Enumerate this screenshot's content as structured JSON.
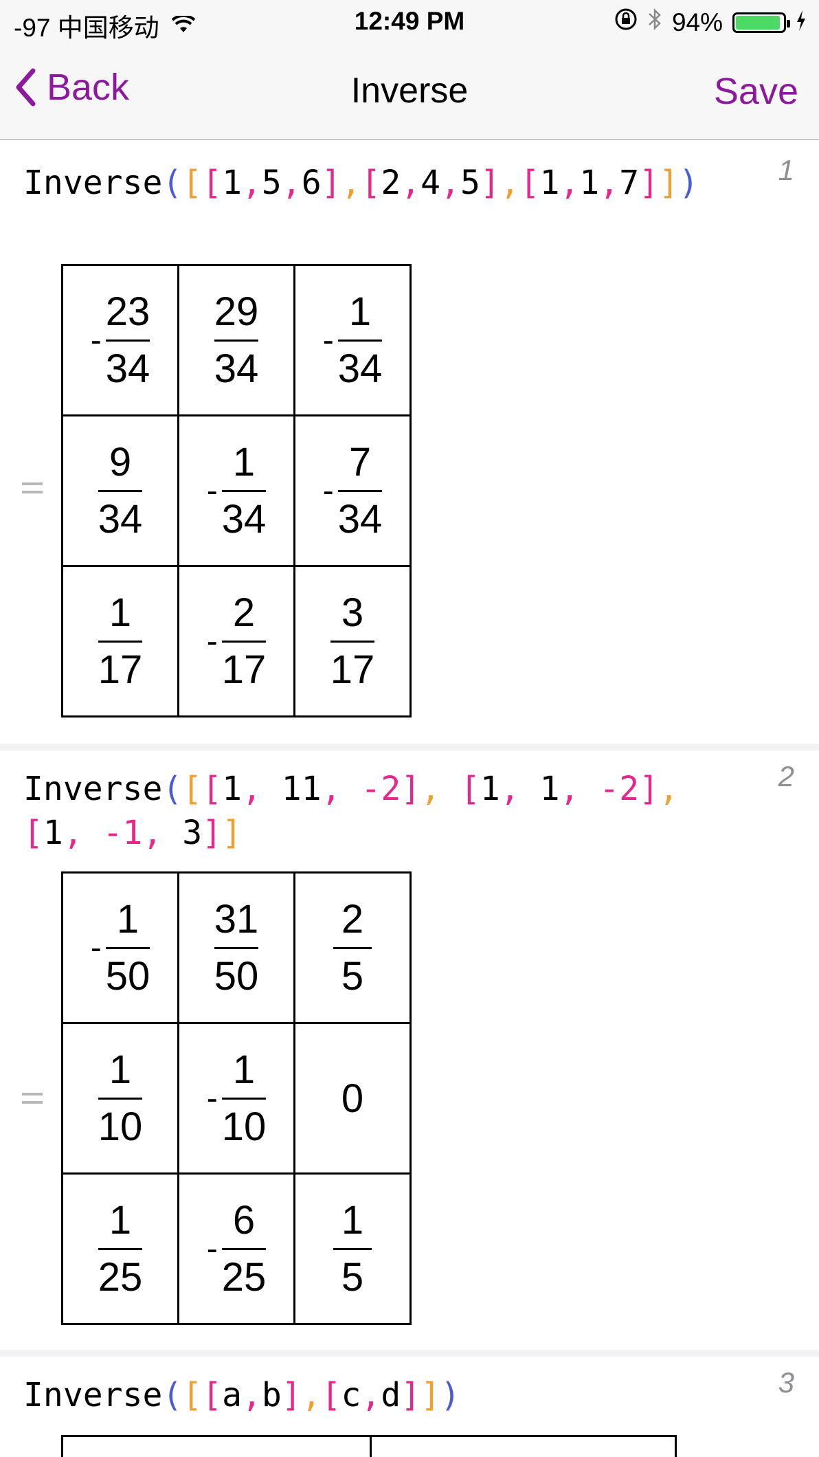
{
  "status_bar": {
    "signal": "-97 中国移动",
    "time": "12:49 PM",
    "battery": "94%",
    "battery_level": 0.94
  },
  "nav": {
    "back_label": "Back",
    "title": "Inverse",
    "save_label": "Save"
  },
  "colors": {
    "accent": "#8b1a9c",
    "paren": "#4a5bd6",
    "bracket_outer": "#f0a030",
    "bracket_inner": "#e6288c"
  },
  "entries": [
    {
      "number": "1",
      "expression": "Inverse([[1,5,6],[2,4,5],[1,1,7]])",
      "result": [
        [
          {
            "sign": "-",
            "num": "23",
            "den": "34"
          },
          {
            "sign": "",
            "num": "29",
            "den": "34"
          },
          {
            "sign": "-",
            "num": "1",
            "den": "34"
          }
        ],
        [
          {
            "sign": "",
            "num": "9",
            "den": "34"
          },
          {
            "sign": "-",
            "num": "1",
            "den": "34"
          },
          {
            "sign": "-",
            "num": "7",
            "den": "34"
          }
        ],
        [
          {
            "sign": "",
            "num": "1",
            "den": "17"
          },
          {
            "sign": "-",
            "num": "2",
            "den": "17"
          },
          {
            "sign": "",
            "num": "3",
            "den": "17"
          }
        ]
      ]
    },
    {
      "number": "2",
      "expression": "Inverse([[1, 11, -2], [1, 1, -2], [1, -1, 3]]",
      "result": [
        [
          {
            "sign": "-",
            "num": "1",
            "den": "50"
          },
          {
            "sign": "",
            "num": "31",
            "den": "50"
          },
          {
            "sign": "",
            "num": "2",
            "den": "5"
          }
        ],
        [
          {
            "sign": "",
            "num": "1",
            "den": "10"
          },
          {
            "sign": "-",
            "num": "1",
            "den": "10"
          },
          {
            "whole": "0"
          }
        ],
        [
          {
            "sign": "",
            "num": "1",
            "den": "25"
          },
          {
            "sign": "-",
            "num": "6",
            "den": "25"
          },
          {
            "sign": "",
            "num": "1",
            "den": "5"
          }
        ]
      ]
    },
    {
      "number": "3",
      "expression": "Inverse([[a,b],[c,d]])"
    }
  ]
}
